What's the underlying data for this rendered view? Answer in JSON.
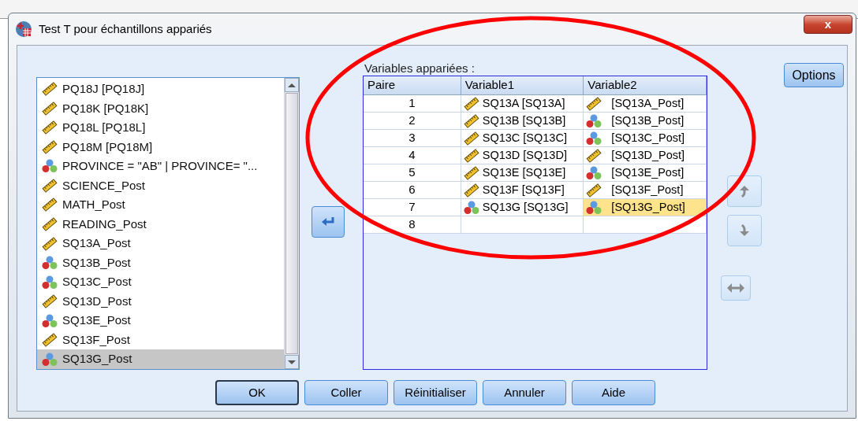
{
  "window": {
    "title": "Test T pour échantillons appariés",
    "close_label": "x"
  },
  "variable_list": {
    "items": [
      {
        "label": "PQ18J [PQ18J]",
        "kind": "scale",
        "selected": false
      },
      {
        "label": "PQ18K [PQ18K]",
        "kind": "scale",
        "selected": false
      },
      {
        "label": "PQ18L [PQ18L]",
        "kind": "scale",
        "selected": false
      },
      {
        "label": "PQ18M [PQ18M]",
        "kind": "scale",
        "selected": false
      },
      {
        "label": "PROVINCE = \"AB\"  |  PROVINCE= \"...",
        "kind": "nominal",
        "selected": false
      },
      {
        "label": "SCIENCE_Post",
        "kind": "scale",
        "selected": false
      },
      {
        "label": "MATH_Post",
        "kind": "scale",
        "selected": false
      },
      {
        "label": "READING_Post",
        "kind": "scale",
        "selected": false
      },
      {
        "label": "SQ13A_Post",
        "kind": "scale",
        "selected": false
      },
      {
        "label": "SQ13B_Post",
        "kind": "nominal",
        "selected": false
      },
      {
        "label": "SQ13C_Post",
        "kind": "nominal",
        "selected": false
      },
      {
        "label": "SQ13D_Post",
        "kind": "scale",
        "selected": false
      },
      {
        "label": "SQ13E_Post",
        "kind": "nominal",
        "selected": false
      },
      {
        "label": "SQ13F_Post",
        "kind": "scale",
        "selected": false
      },
      {
        "label": "SQ13G_Post",
        "kind": "nominal",
        "selected": true
      }
    ]
  },
  "paired_variables": {
    "label": "Variables appariées :",
    "columns": [
      "Paire",
      "Variable1",
      "Variable2"
    ],
    "rows": [
      {
        "pair": "1",
        "variable1": {
          "label": "SQ13A [SQ13A]",
          "kind": "scale"
        },
        "variable2": {
          "label": "[SQ13A_Post]",
          "kind": "scale",
          "selected": false
        }
      },
      {
        "pair": "2",
        "variable1": {
          "label": "SQ13B [SQ13B]",
          "kind": "scale"
        },
        "variable2": {
          "label": "[SQ13B_Post]",
          "kind": "nominal",
          "selected": false
        }
      },
      {
        "pair": "3",
        "variable1": {
          "label": "SQ13C [SQ13C]",
          "kind": "scale"
        },
        "variable2": {
          "label": "[SQ13C_Post]",
          "kind": "nominal",
          "selected": false
        }
      },
      {
        "pair": "4",
        "variable1": {
          "label": "SQ13D [SQ13D]",
          "kind": "scale"
        },
        "variable2": {
          "label": "[SQ13D_Post]",
          "kind": "scale",
          "selected": false
        }
      },
      {
        "pair": "5",
        "variable1": {
          "label": "SQ13E [SQ13E]",
          "kind": "scale"
        },
        "variable2": {
          "label": "[SQ13E_Post]",
          "kind": "nominal",
          "selected": false
        }
      },
      {
        "pair": "6",
        "variable1": {
          "label": "SQ13F [SQ13F]",
          "kind": "scale"
        },
        "variable2": {
          "label": "[SQ13F_Post]",
          "kind": "scale",
          "selected": false
        }
      },
      {
        "pair": "7",
        "variable1": {
          "label": "SQ13G [SQ13G]",
          "kind": "nominal"
        },
        "variable2": {
          "label": "[SQ13G_Post]",
          "kind": "nominal",
          "selected": true
        }
      },
      {
        "pair": "8"
      }
    ]
  },
  "options_button": "Options",
  "side_buttons": [
    {
      "kind": "up",
      "disabled": true
    },
    {
      "kind": "down",
      "disabled": true
    },
    {
      "kind": "swap",
      "disabled": true
    }
  ],
  "move_button": {
    "disabled": false
  },
  "buttons": [
    {
      "label": "OK",
      "default": true
    },
    {
      "label": "Coller",
      "default": false
    },
    {
      "label": "Réinitialiser",
      "default": false
    },
    {
      "label": "Annuler",
      "default": false
    },
    {
      "label": "Aide",
      "default": false
    }
  ]
}
